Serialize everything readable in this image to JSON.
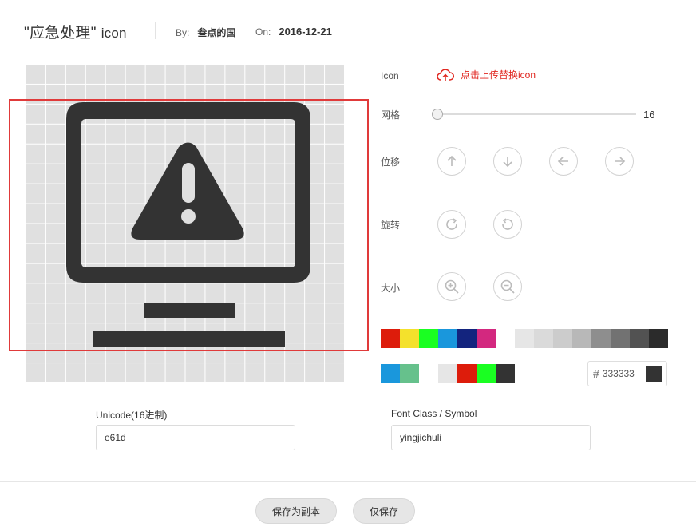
{
  "header": {
    "title": "\"应急处理\"",
    "title_suffix": "icon",
    "by_label": "By:",
    "by_value": "叁点的国",
    "on_label": "On:",
    "on_value": "2016-12-21"
  },
  "panel": {
    "icon_label": "Icon",
    "upload_text": "点击上传替换icon",
    "grid_label": "网格",
    "grid_value": "16",
    "move_label": "位移",
    "rotate_label": "旋转",
    "size_label": "大小"
  },
  "palette": {
    "row1": [
      "#dd1c0b",
      "#f4e12c",
      "#1aff22",
      "#1a97dc",
      "#13247e",
      "#d3287f",
      "#ffffff",
      "#e6e6e6",
      "#dadada",
      "#cccccc",
      "#b8b8b8",
      "#8e8e8e",
      "#727272",
      "#525252",
      "#2b2b2b"
    ],
    "row2": [
      "#1a97dc",
      "#66c18c",
      "#ffffff",
      "#e6e6e6",
      "#dd1c0b",
      "#1aff22",
      "#333333"
    ],
    "hash": "#",
    "current": "333333"
  },
  "fields": {
    "unicode_label": "Unicode(16进制)",
    "unicode_value": "e61d",
    "fontclass_label": "Font Class / Symbol",
    "fontclass_value": "yingjichuli"
  },
  "footer": {
    "save_copy": "保存为副本",
    "save_only": "仅保存"
  },
  "icons": {
    "upload": "cloud-upload-icon",
    "glyph": "monitor-warning-icon"
  }
}
